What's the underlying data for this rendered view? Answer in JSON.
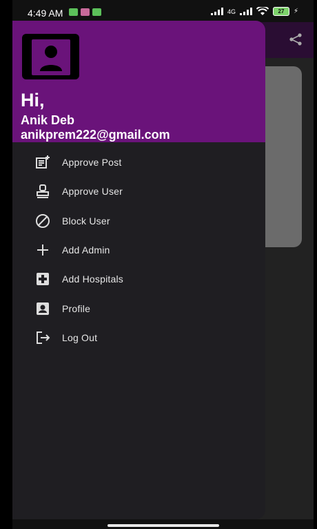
{
  "status_bar": {
    "time": "4:49 AM",
    "network": "4G",
    "battery": "27"
  },
  "drawer": {
    "header": {
      "greeting": "Hi,",
      "name": "Anik Deb",
      "email": "anikprem222@gmail.com",
      "background_color": "#6a137a"
    },
    "items": [
      {
        "label": "Approve Post",
        "icon": "post-add-icon"
      },
      {
        "label": "Approve User",
        "icon": "approval-stamp-icon"
      },
      {
        "label": "Block User",
        "icon": "block-icon"
      },
      {
        "label": "Add Admin",
        "icon": "plus-icon"
      },
      {
        "label": "Add Hospitals",
        "icon": "local-hospital-icon"
      },
      {
        "label": "Profile",
        "icon": "account-box-icon"
      },
      {
        "label": "Log Out",
        "icon": "logout-icon"
      }
    ]
  },
  "colors": {
    "app_bar": "#2a0d33",
    "drawer_bg": "#1f1e22",
    "screen_bg": "#222222"
  }
}
